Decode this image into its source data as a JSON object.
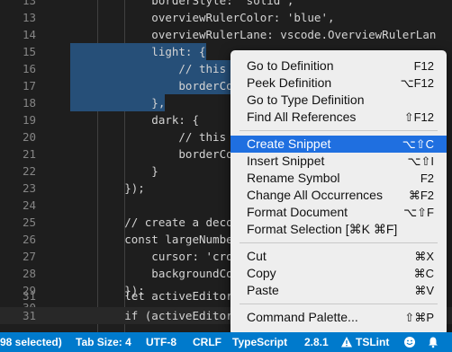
{
  "editor": {
    "lines": [
      {
        "num": "13",
        "text": "            borderStyle: 'solid',"
      },
      {
        "num": "13",
        "text": "            overviewRulerColor: 'blue',"
      },
      {
        "num": "14",
        "text": "            overviewRulerLane: vscode.OverviewRulerLan"
      },
      {
        "num": "15",
        "text": "            light: {"
      },
      {
        "num": "16",
        "text": "                // this colo"
      },
      {
        "num": "17",
        "text": "                borderColor:"
      },
      {
        "num": "18",
        "text": "            },"
      },
      {
        "num": "19",
        "text": "            dark: {"
      },
      {
        "num": "20",
        "text": "                // this colo"
      },
      {
        "num": "21",
        "text": "                borderColor:"
      },
      {
        "num": "22",
        "text": "            }"
      },
      {
        "num": "23",
        "text": "        });"
      },
      {
        "num": "24",
        "text": ""
      },
      {
        "num": "25",
        "text": "        // create a decorator typ"
      },
      {
        "num": "26",
        "text": "        const largeNumberDecorat"
      },
      {
        "num": "27",
        "text": "            cursor: 'crosshair',"
      },
      {
        "num": "28",
        "text": "            backgroundColor: 'rgb"
      },
      {
        "num": "29",
        "text": "        });"
      },
      {
        "num": "30",
        "text": ""
      },
      {
        "num": "31",
        "text": "        let activeEditor = vscode"
      },
      {
        "num": "31",
        "text": "        if (activeEditor) {"
      }
    ]
  },
  "context_menu": {
    "items": [
      {
        "label": "Go to Definition",
        "shortcut": "F12"
      },
      {
        "label": "Peek Definition",
        "shortcut": "⌥F12"
      },
      {
        "label": "Go to Type Definition",
        "shortcut": ""
      },
      {
        "label": "Find All References",
        "shortcut": "⇧F12"
      },
      {
        "label": "Create Snippet",
        "shortcut": "⌥⇧C"
      },
      {
        "label": "Insert Snippet",
        "shortcut": "⌥⇧I"
      },
      {
        "label": "Rename Symbol",
        "shortcut": "F2"
      },
      {
        "label": "Change All Occurrences",
        "shortcut": "⌘F2"
      },
      {
        "label": "Format Document",
        "shortcut": "⌥⇧F"
      },
      {
        "label": "Format Selection [⌘K ⌘F]",
        "shortcut": ""
      },
      {
        "label": "Cut",
        "shortcut": "⌘X"
      },
      {
        "label": "Copy",
        "shortcut": "⌘C"
      },
      {
        "label": "Paste",
        "shortcut": "⌘V"
      },
      {
        "label": "Command Palette...",
        "shortcut": "⇧⌘P"
      }
    ],
    "active_item": "Create Snippet"
  },
  "status_bar": {
    "selection": "98 selected)",
    "tab_size": "Tab Size: 4",
    "encoding": "UTF-8",
    "line_ending": "CRLF",
    "language": "TypeScript",
    "version": "2.8.1",
    "tslint": "TSLint",
    "color": "#007acc"
  }
}
